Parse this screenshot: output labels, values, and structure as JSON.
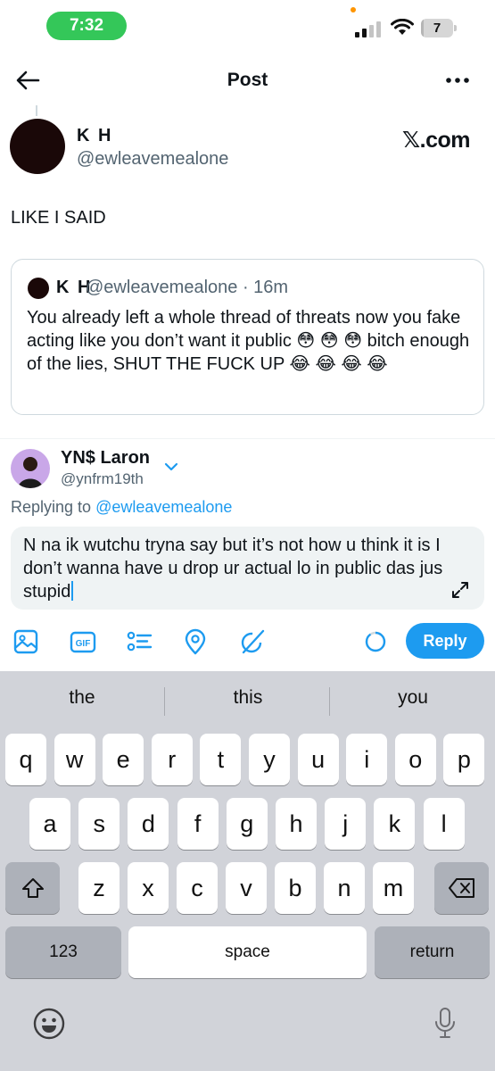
{
  "status_bar": {
    "time": "7:32",
    "battery_level": "7",
    "battery_fraction": 0.07
  },
  "header": {
    "title": "Post",
    "back_icon": "back-arrow-icon",
    "more_icon": "more-dots-icon"
  },
  "post": {
    "name": "K H",
    "handle": "@ewleavemealone",
    "source": "𝕏.com",
    "text": "LIKE I SAID"
  },
  "quote": {
    "name": "K H",
    "handle": "@ewleavemealone · 16m",
    "body": "You already left a whole thread of threats now you fake acting like you don’t want it public 😳 😳 😳 bitch enough of the lies, SHUT THE FUCK UP 😂 😂 😂 😂"
  },
  "reply": {
    "name": "YN$ Laron",
    "handle": "@ynfrm19th",
    "replying_prefix": "Replying to ",
    "replying_mention": "@ewleavemealone",
    "draft": "N na ik wutchu tryna say but it’s not how u think it is I don’t wanna have u drop ur actual lo in public das jus stupid",
    "reply_button": "Reply"
  },
  "toolbar": {
    "icons": [
      "image-icon",
      "gif-icon",
      "poll-icon",
      "location-icon",
      "grok-icon"
    ],
    "gif_label": "GIF",
    "progress_fraction": 0.9
  },
  "keyboard": {
    "suggestions": [
      "the",
      "this",
      "you"
    ],
    "row1": [
      "q",
      "w",
      "e",
      "r",
      "t",
      "y",
      "u",
      "i",
      "o",
      "p"
    ],
    "row2": [
      "a",
      "s",
      "d",
      "f",
      "g",
      "h",
      "j",
      "k",
      "l"
    ],
    "row3": [
      "z",
      "x",
      "c",
      "v",
      "b",
      "n",
      "m"
    ],
    "numbers_key": "123",
    "space_key": "space",
    "return_key": "return"
  },
  "colors": {
    "accent": "#1d9bf0",
    "time_pill": "#34c759",
    "keyboard_bg": "#d1d3d9",
    "secondary_text": "#536471"
  }
}
